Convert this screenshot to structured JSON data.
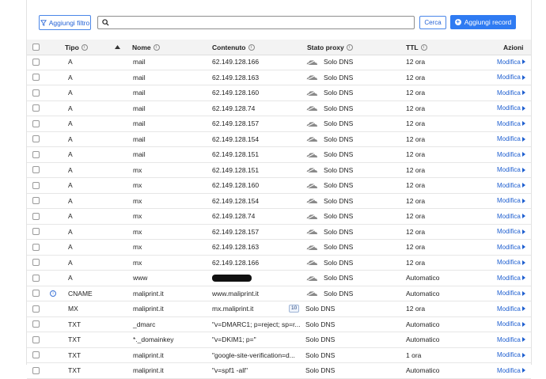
{
  "toolbar": {
    "filter_label": "Aggiungi filtro",
    "search_value": "",
    "search_placeholder": "",
    "search_button": "Cerca",
    "add_button": "Aggiungi record"
  },
  "columns": {
    "type": "Tipo",
    "name": "Nome",
    "content": "Contenuto",
    "proxy": "Stato proxy",
    "ttl": "TTL",
    "actions": "Azioni"
  },
  "edit_label": "Modifica",
  "rows": [
    {
      "type": "A",
      "name": "mail",
      "content": "62.149.128.166",
      "proxy": "Solo DNS",
      "cloud": true,
      "ttl": "12 ora"
    },
    {
      "type": "A",
      "name": "mail",
      "content": "62.149.128.163",
      "proxy": "Solo DNS",
      "cloud": true,
      "ttl": "12 ora"
    },
    {
      "type": "A",
      "name": "mail",
      "content": "62.149.128.160",
      "proxy": "Solo DNS",
      "cloud": true,
      "ttl": "12 ora"
    },
    {
      "type": "A",
      "name": "mail",
      "content": "62.149.128.74",
      "proxy": "Solo DNS",
      "cloud": true,
      "ttl": "12 ora"
    },
    {
      "type": "A",
      "name": "mail",
      "content": "62.149.128.157",
      "proxy": "Solo DNS",
      "cloud": true,
      "ttl": "12 ora"
    },
    {
      "type": "A",
      "name": "mail",
      "content": "62.149.128.154",
      "proxy": "Solo DNS",
      "cloud": true,
      "ttl": "12 ora"
    },
    {
      "type": "A",
      "name": "mail",
      "content": "62.149.128.151",
      "proxy": "Solo DNS",
      "cloud": true,
      "ttl": "12 ora"
    },
    {
      "type": "A",
      "name": "mx",
      "content": "62.149.128.151",
      "proxy": "Solo DNS",
      "cloud": true,
      "ttl": "12 ora"
    },
    {
      "type": "A",
      "name": "mx",
      "content": "62.149.128.160",
      "proxy": "Solo DNS",
      "cloud": true,
      "ttl": "12 ora"
    },
    {
      "type": "A",
      "name": "mx",
      "content": "62.149.128.154",
      "proxy": "Solo DNS",
      "cloud": true,
      "ttl": "12 ora"
    },
    {
      "type": "A",
      "name": "mx",
      "content": "62.149.128.74",
      "proxy": "Solo DNS",
      "cloud": true,
      "ttl": "12 ora"
    },
    {
      "type": "A",
      "name": "mx",
      "content": "62.149.128.157",
      "proxy": "Solo DNS",
      "cloud": true,
      "ttl": "12 ora"
    },
    {
      "type": "A",
      "name": "mx",
      "content": "62.149.128.163",
      "proxy": "Solo DNS",
      "cloud": true,
      "ttl": "12 ora"
    },
    {
      "type": "A",
      "name": "mx",
      "content": "62.149.128.166",
      "proxy": "Solo DNS",
      "cloud": true,
      "ttl": "12 ora"
    },
    {
      "type": "A",
      "name": "www",
      "content": "",
      "redacted": true,
      "proxy": "Solo DNS",
      "cloud": true,
      "ttl": "Automatico"
    },
    {
      "type": "CNAME",
      "name": "maliprint.it",
      "content": "www.maliprint.it",
      "proxy": "Solo DNS",
      "cloud": true,
      "ttl": "Automatico",
      "info": true
    },
    {
      "type": "MX",
      "name": "maliprint.it",
      "content": "mx.maliprint.it",
      "priority": "10",
      "proxy": "Solo DNS",
      "cloud": false,
      "ttl": "12 ora"
    },
    {
      "type": "TXT",
      "name": "_dmarc",
      "content": "\"v=DMARC1; p=reject; sp=r...",
      "proxy": "Solo DNS",
      "cloud": false,
      "ttl": "Automatico"
    },
    {
      "type": "TXT",
      "name": "*._domainkey",
      "content": "\"v=DKIM1; p=\"",
      "proxy": "Solo DNS",
      "cloud": false,
      "ttl": "Automatico"
    },
    {
      "type": "TXT",
      "name": "maliprint.it",
      "content": "\"google-site-verification=d...",
      "proxy": "Solo DNS",
      "cloud": false,
      "ttl": "1 ora"
    },
    {
      "type": "TXT",
      "name": "maliprint.it",
      "content": "\"v=spf1 -all\"",
      "proxy": "Solo DNS",
      "cloud": false,
      "ttl": "Automatico"
    }
  ]
}
